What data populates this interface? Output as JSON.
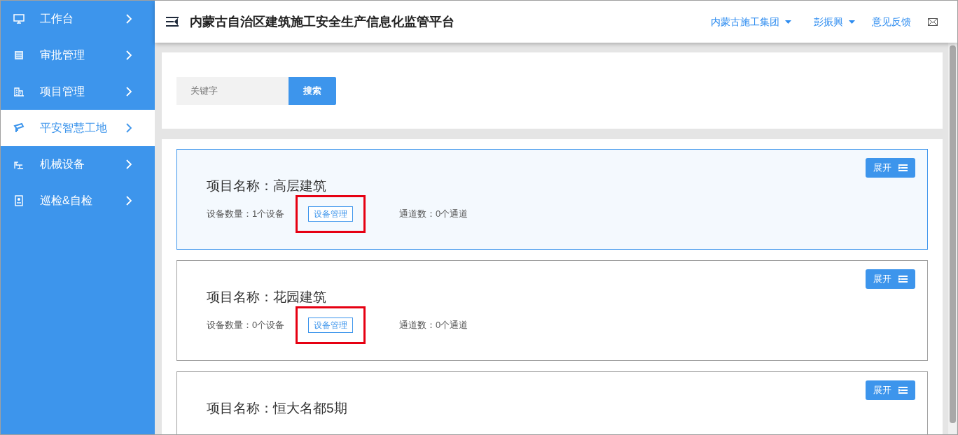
{
  "sidebar": {
    "items": [
      {
        "label": "工作台",
        "selected": false
      },
      {
        "label": "审批管理",
        "selected": false
      },
      {
        "label": "项目管理",
        "selected": false
      },
      {
        "label": "平安智慧工地",
        "selected": true
      },
      {
        "label": "机械设备",
        "selected": false
      },
      {
        "label": "巡检&自检",
        "selected": false
      }
    ]
  },
  "header": {
    "title": "内蒙古自治区建筑施工安全生产信息化监管平台",
    "company": "内蒙古施工集团",
    "user": "彭振興",
    "feedback": "意见反馈"
  },
  "search": {
    "placeholder": "关键字",
    "button": "搜索"
  },
  "projects": [
    {
      "name": "项目名称：高层建筑",
      "devices": "设备数量：1个设备",
      "manage": "设备管理",
      "channels": "通道数：0个通道",
      "expand": "展开",
      "selected": true,
      "highlighted": true
    },
    {
      "name": "项目名称：花园建筑",
      "devices": "设备数量：0个设备",
      "manage": "设备管理",
      "channels": "通道数：0个通道",
      "expand": "展开",
      "selected": false,
      "highlighted": true
    },
    {
      "name": "项目名称：恒大名都5期",
      "expand": "展开",
      "selected": false
    }
  ]
}
